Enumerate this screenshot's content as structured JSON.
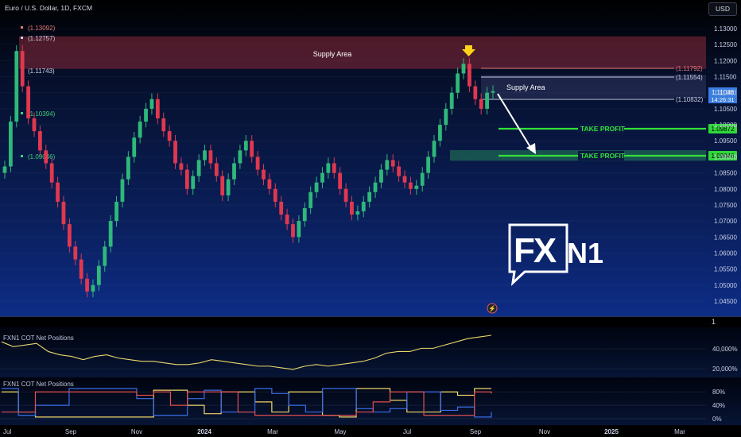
{
  "header": {
    "symbol": "Euro / U.S. Dollar, 1D, FXCM",
    "currency_button": "USD"
  },
  "chart_data": {
    "type": "candlestick",
    "title": "Euro / U.S. Dollar, 1D, FXCM",
    "ylim": [
      1.04,
      1.135
    ],
    "y_ticks": [
      "1.13000",
      "1.12500",
      "1.12000",
      "1.11500",
      "1.11000",
      "1.10500",
      "1.10000",
      "1.09500",
      "1.09000",
      "1.08500",
      "1.08000",
      "1.07500",
      "1.07000",
      "1.06500",
      "1.06000",
      "1.05500",
      "1.05000",
      "1.04500"
    ],
    "x_ticks": [
      "Jul",
      "Sep",
      "Nov",
      "2024",
      "Mar",
      "May",
      "Jul",
      "Sep",
      "Nov",
      "2025",
      "Mar"
    ],
    "closes_approx": [
      1.087,
      1.101,
      1.123,
      1.112,
      1.102,
      1.098,
      1.092,
      1.088,
      1.082,
      1.076,
      1.069,
      1.062,
      1.058,
      1.052,
      1.048,
      1.05,
      1.056,
      1.062,
      1.07,
      1.076,
      1.083,
      1.09,
      1.096,
      1.101,
      1.105,
      1.108,
      1.102,
      1.098,
      1.095,
      1.088,
      1.086,
      1.08,
      1.084,
      1.089,
      1.092,
      1.088,
      1.084,
      1.078,
      1.083,
      1.088,
      1.092,
      1.095,
      1.09,
      1.086,
      1.083,
      1.08,
      1.076,
      1.072,
      1.069,
      1.065,
      1.07,
      1.074,
      1.079,
      1.082,
      1.085,
      1.088,
      1.085,
      1.08,
      1.076,
      1.072,
      1.073,
      1.076,
      1.079,
      1.082,
      1.086,
      1.089,
      1.087,
      1.084,
      1.082,
      1.08,
      1.081,
      1.085,
      1.09,
      1.095,
      1.1,
      1.105,
      1.11,
      1.116,
      1.119,
      1.112,
      1.108,
      1.105,
      1.11,
      1.1105
    ],
    "levels": [
      {
        "label": "(1.13092)",
        "value": 1.13092
      },
      {
        "label": "(1.12757)",
        "value": 1.12757
      },
      {
        "label": "(1.11743)",
        "value": 1.11743
      },
      {
        "label": "(1.10394)",
        "value": 1.10394
      },
      {
        "label": "(1.09046)",
        "value": 1.09046
      },
      {
        "label": "(1.11792)",
        "value": 1.11792
      },
      {
        "label": "(1.11554)",
        "value": 1.11554
      },
      {
        "label": "(1.10832)",
        "value": 1.10832
      }
    ],
    "zones": [
      {
        "label": "Supply Area",
        "from": 1.11743,
        "to": 1.12757
      },
      {
        "label": "Supply Area",
        "from": 1.10832,
        "to": 1.11554
      }
    ],
    "take_profit": [
      {
        "label": "TAKE PROFIT",
        "value": 1.09872,
        "tag": "1.09872"
      },
      {
        "label": "TAKE PROFIT",
        "value": 1.09046,
        "tag": "1.09046"
      }
    ],
    "last_price": "1.11046",
    "countdown": "14:26:31",
    "logo": "FXN1"
  },
  "separator": {
    "value": "1"
  },
  "indicator1": {
    "label": "FXN1 COT Net Positions",
    "ticks": [
      "40,000%",
      "20,000%"
    ],
    "values": [
      58,
      55,
      56,
      57,
      52,
      50,
      49,
      47,
      49,
      50,
      48,
      47,
      46,
      46,
      45,
      44,
      44,
      45,
      47,
      46,
      45,
      44,
      43,
      43,
      42,
      41,
      43,
      44,
      43,
      44,
      45,
      46,
      48,
      51,
      52,
      52,
      54,
      54,
      56,
      58,
      60,
      61,
      62
    ]
  },
  "indicator2": {
    "label": "FXN1 COT Net Positions",
    "ticks": [
      "80%",
      "40%",
      "0%"
    ],
    "series": [
      {
        "name": "yellow",
        "values": [
          80,
          20,
          5,
          5,
          5,
          5,
          5,
          5,
          5,
          85,
          85,
          40,
          15,
          80,
          80,
          50,
          20,
          80,
          80,
          10,
          5,
          90,
          90,
          55,
          20,
          20,
          80,
          70,
          90,
          90
        ]
      },
      {
        "name": "blue",
        "values": [
          90,
          10,
          40,
          40,
          90,
          90,
          90,
          90,
          60,
          10,
          10,
          60,
          85,
          20,
          20,
          90,
          75,
          40,
          20,
          90,
          90,
          30,
          20,
          30,
          80,
          80,
          25,
          35,
          5,
          20
        ]
      },
      {
        "name": "red",
        "values": [
          20,
          20,
          80,
          80,
          80,
          80,
          80,
          80,
          70,
          80,
          40,
          80,
          80,
          80,
          20,
          10,
          10,
          10,
          10,
          10,
          10,
          20,
          50,
          80,
          80,
          10,
          10,
          10,
          80,
          75
        ]
      }
    ]
  }
}
